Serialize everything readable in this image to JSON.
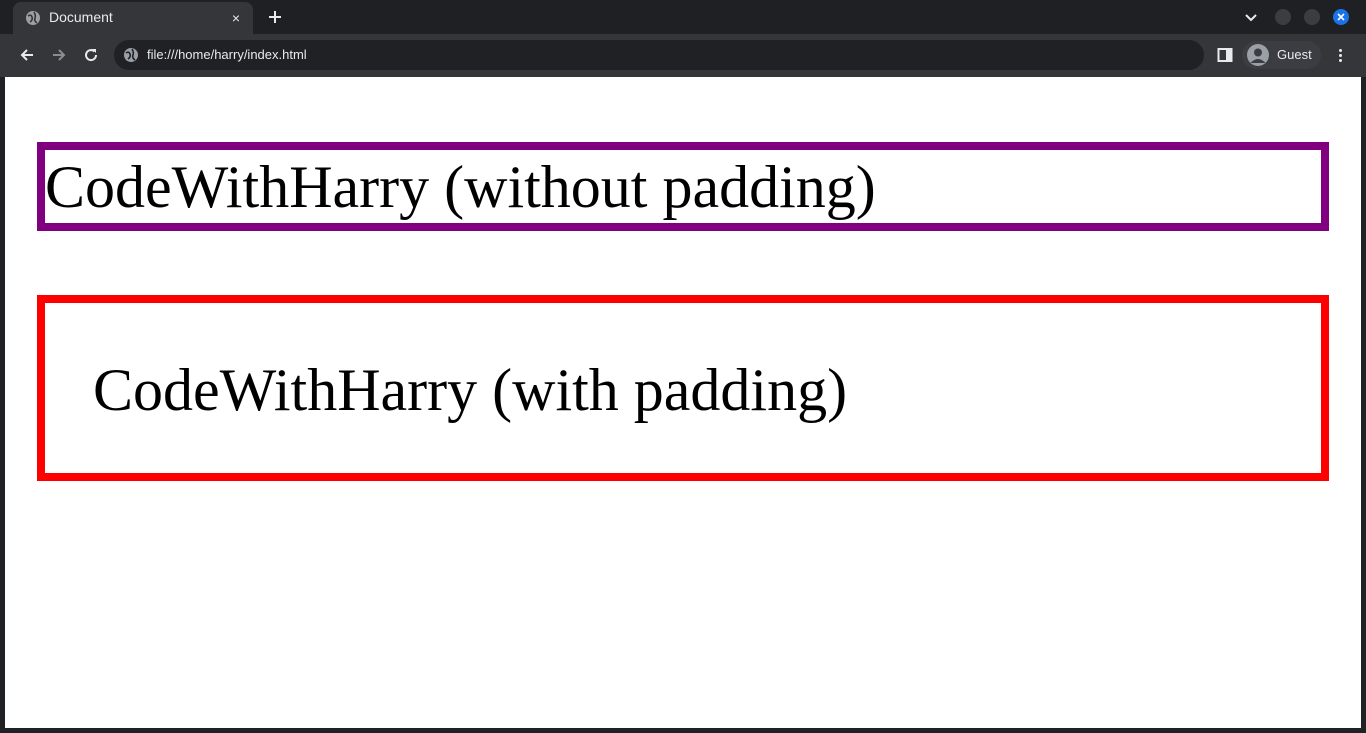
{
  "browser": {
    "tab": {
      "title": "Document",
      "favicon": "globe-icon",
      "close": "×"
    },
    "new_tab": "plus-icon",
    "toolbar": {
      "url": "file:///home/harry/index.html",
      "site_icon": "globe-icon",
      "profile_label": "Guest"
    },
    "colors": {
      "frame": "#202124",
      "tab_active": "#35363a",
      "accent": "#1a73e8"
    }
  },
  "page": {
    "box_without_padding": {
      "text": "CodeWithHarry (without padding)",
      "border_color": "#800080"
    },
    "box_with_padding": {
      "text": "CodeWithHarry (with padding)",
      "border_color": "#ff0000"
    }
  }
}
